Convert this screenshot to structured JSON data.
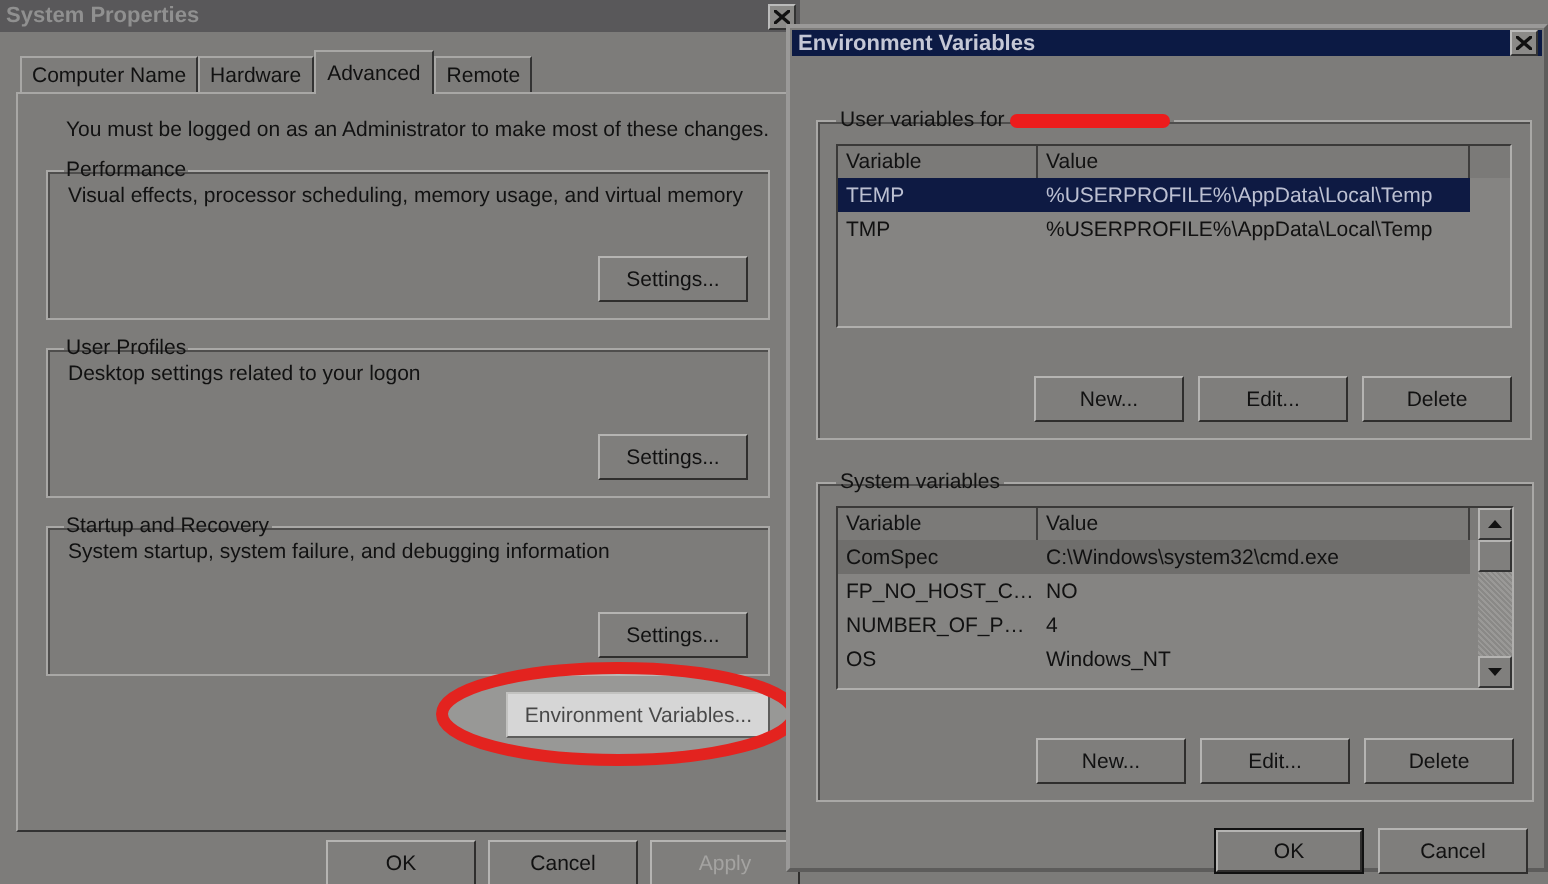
{
  "system_properties": {
    "title": "System Properties",
    "tabs": [
      {
        "label": "Computer Name",
        "selected": false
      },
      {
        "label": "Hardware",
        "selected": false
      },
      {
        "label": "Advanced",
        "selected": true
      },
      {
        "label": "Remote",
        "selected": false
      }
    ],
    "notice": "You must be logged on as an Administrator to make most of these changes.",
    "groups": [
      {
        "title": "Performance",
        "description": "Visual effects, processor scheduling, memory usage, and virtual memory",
        "button": "Settings..."
      },
      {
        "title": "User Profiles",
        "description": "Desktop settings related to your logon",
        "button": "Settings..."
      },
      {
        "title": "Startup and Recovery",
        "description": "System startup, system failure, and debugging information",
        "button": "Settings..."
      }
    ],
    "environment_button": {
      "label": "Environment Variables...",
      "highlighted": true
    },
    "buttons": [
      {
        "label": "OK",
        "disabled": false
      },
      {
        "label": "Cancel",
        "disabled": false
      },
      {
        "label": "Apply",
        "disabled": true
      }
    ]
  },
  "environment_variables": {
    "title": "Environment Variables",
    "sections": [
      {
        "label": "User variables for",
        "redacted": true,
        "focused": true,
        "scrollbar": false,
        "columns": [
          "Variable",
          "Value"
        ],
        "rows": [
          {
            "variable": "TEMP",
            "value": "%USERPROFILE%\\AppData\\Local\\Temp",
            "selected": true
          },
          {
            "variable": "TMP",
            "value": "%USERPROFILE%\\AppData\\Local\\Temp",
            "selected": false
          }
        ],
        "buttons": [
          "New...",
          "Edit...",
          "Delete"
        ]
      },
      {
        "label": "System variables",
        "redacted": false,
        "focused": false,
        "scrollbar": true,
        "columns": [
          "Variable",
          "Value"
        ],
        "rows": [
          {
            "variable": "ComSpec",
            "value": "C:\\Windows\\system32\\cmd.exe",
            "selected": true
          },
          {
            "variable": "FP_NO_HOST_C…",
            "value": "NO",
            "selected": false
          },
          {
            "variable": "NUMBER_OF_P…",
            "value": "4",
            "selected": false
          },
          {
            "variable": "OS",
            "value": "Windows_NT",
            "selected": false
          }
        ],
        "buttons": [
          "New...",
          "Edit...",
          "Delete"
        ]
      }
    ],
    "buttons": [
      {
        "label": "OK",
        "default": true
      },
      {
        "label": "Cancel",
        "default": false
      }
    ]
  }
}
